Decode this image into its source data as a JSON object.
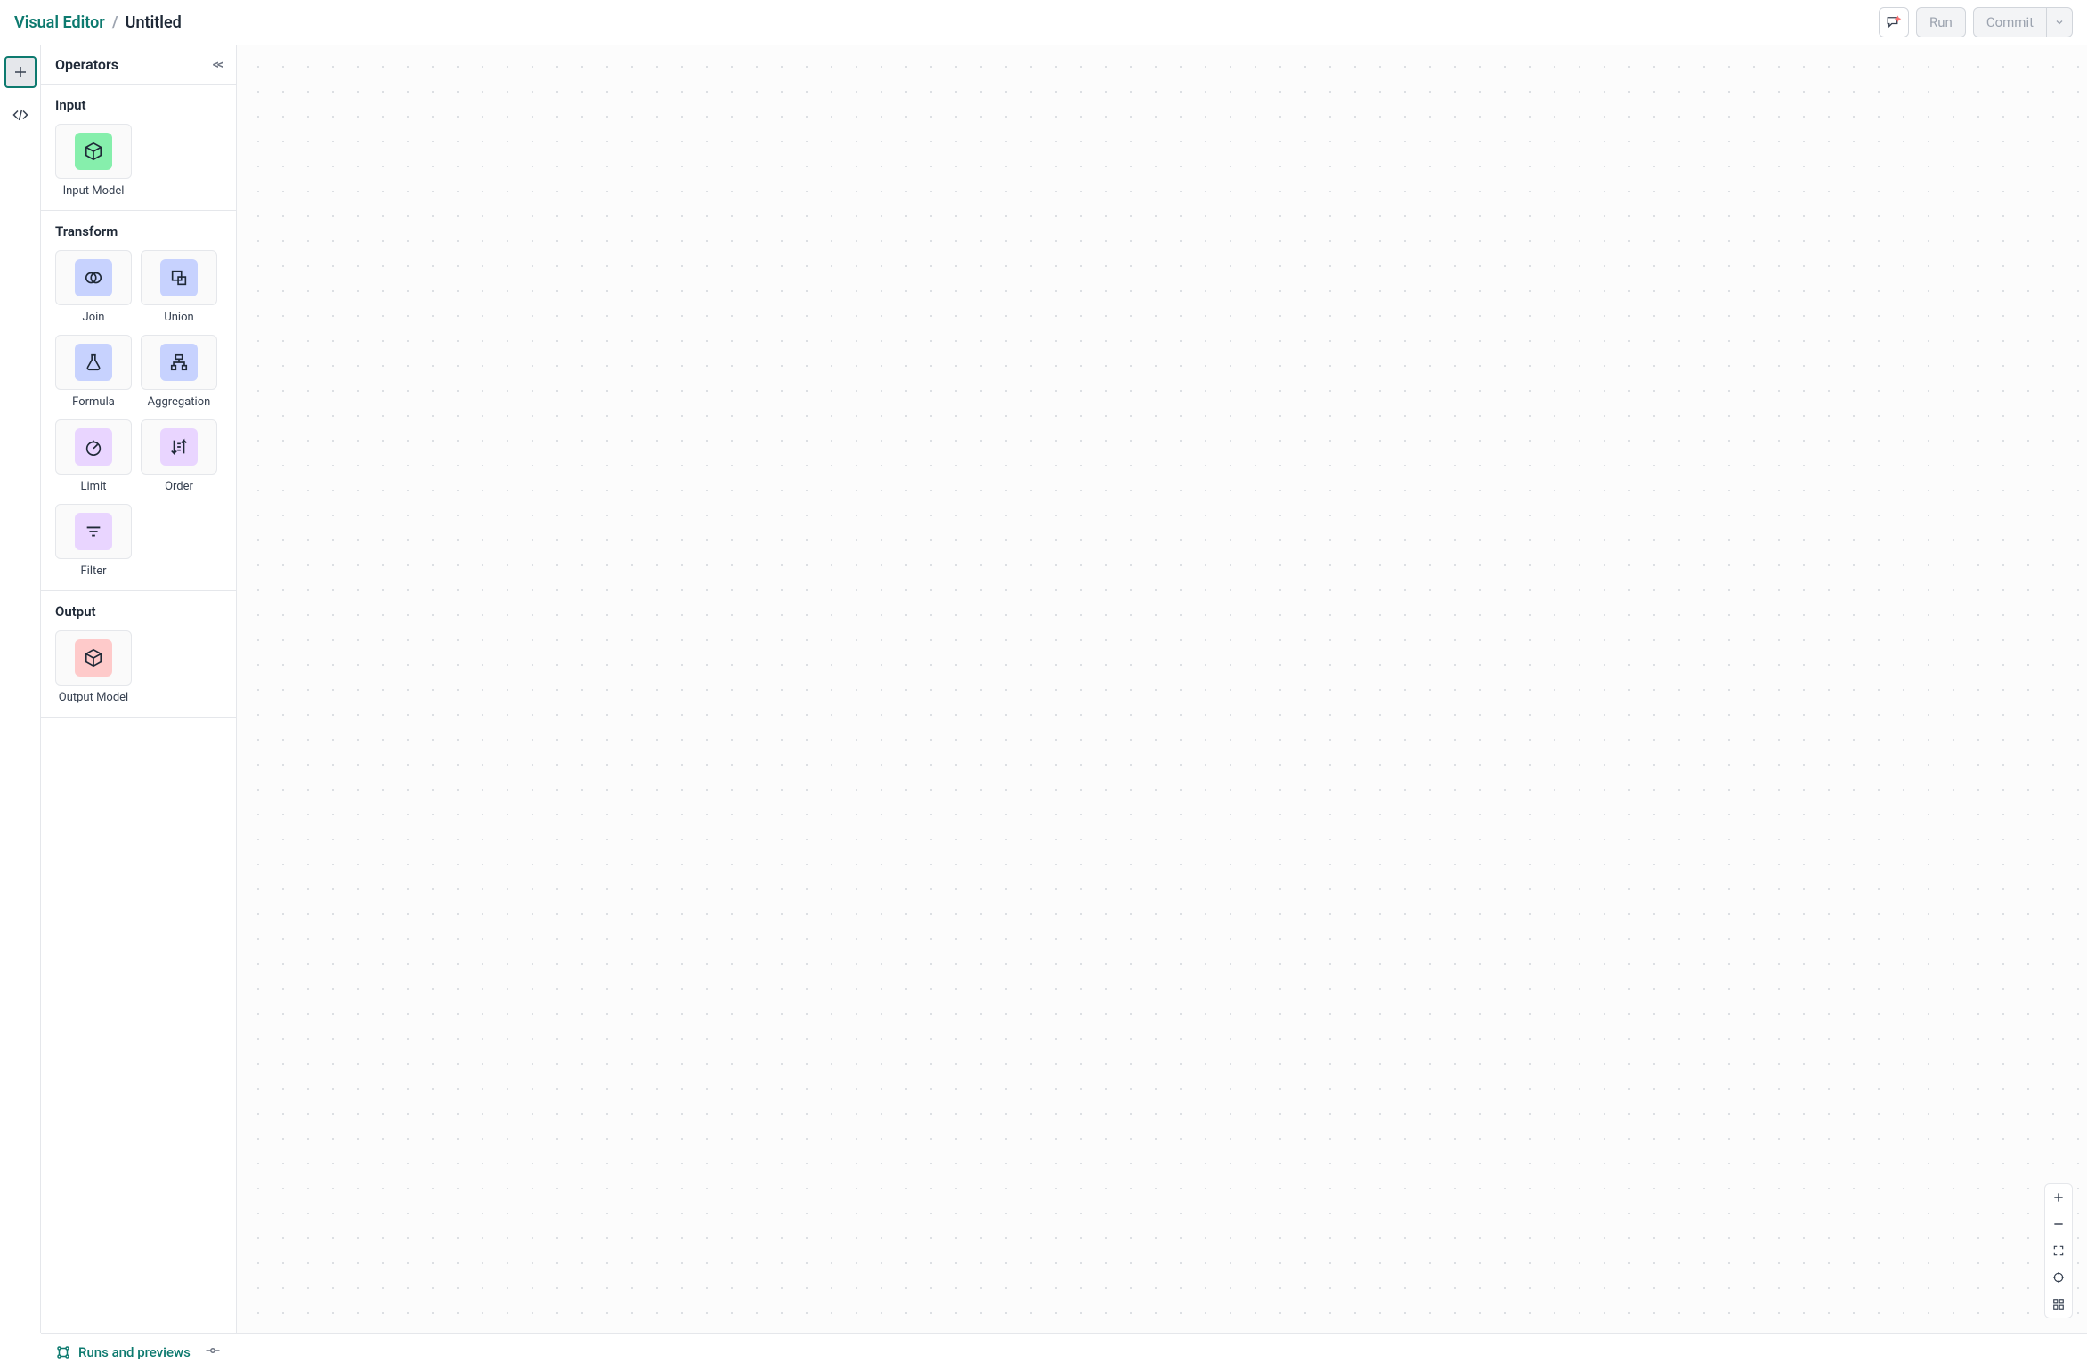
{
  "header": {
    "breadcrumb_root": "Visual Editor",
    "breadcrumb_sep": "/",
    "breadcrumb_current": "Untitled",
    "run_label": "Run",
    "commit_label": "Commit"
  },
  "sidebar": {
    "title": "Operators",
    "groups": {
      "input": {
        "title": "Input",
        "items": [
          {
            "label": "Input Model",
            "icon": "cube",
            "color": "green"
          }
        ]
      },
      "transform": {
        "title": "Transform",
        "items": [
          {
            "label": "Join",
            "icon": "venn",
            "color": "blue"
          },
          {
            "label": "Union",
            "icon": "union-shapes",
            "color": "blue"
          },
          {
            "label": "Formula",
            "icon": "flask",
            "color": "blue"
          },
          {
            "label": "Aggregation",
            "icon": "hierarchy",
            "color": "blue"
          },
          {
            "label": "Limit",
            "icon": "gauge",
            "color": "purple"
          },
          {
            "label": "Order",
            "icon": "sort",
            "color": "purple"
          },
          {
            "label": "Filter",
            "icon": "filter-lines",
            "color": "purple"
          }
        ]
      },
      "output": {
        "title": "Output",
        "items": [
          {
            "label": "Output Model",
            "icon": "cube",
            "color": "peach"
          }
        ]
      }
    }
  },
  "footer": {
    "runs_label": "Runs and previews"
  }
}
